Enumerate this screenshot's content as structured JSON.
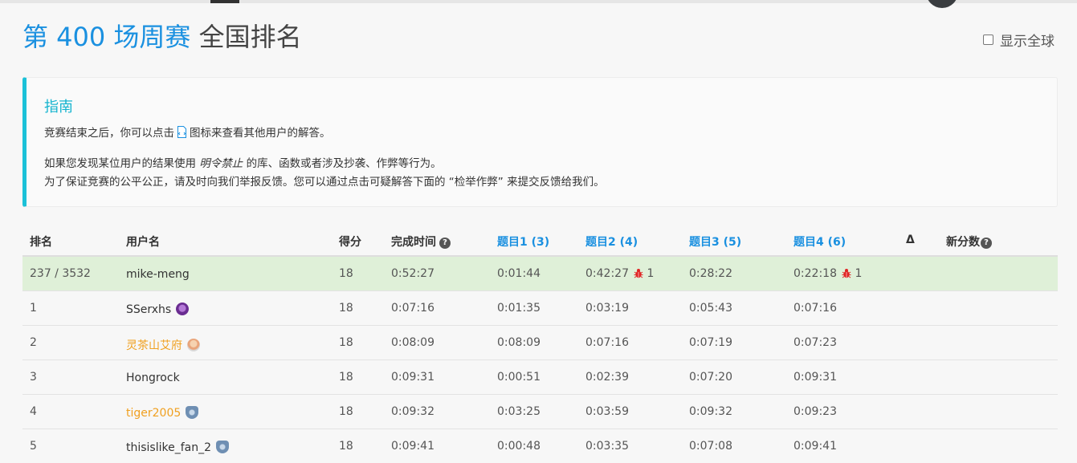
{
  "header": {
    "title_accent": "第 400 场周赛",
    "title_rest": "全国排名",
    "toggle_label": "显示全球"
  },
  "guide": {
    "title": "指南",
    "line1_before": "竞赛结束之后，你可以点击",
    "line1_after": "图标来查看其他用户的解答。",
    "line2_before": "如果您发现某位用户的结果使用",
    "line2_em": "明令禁止",
    "line2_after": "的库、函数或者涉及抄袭、作弊等行为。",
    "line3": "为了保证竞赛的公平公正，请及时向我们举报反馈。您可以通过点击可疑解答下面的 “检举作弊” 来提交反馈给我们。"
  },
  "table": {
    "headers": {
      "rank": "排名",
      "username": "用户名",
      "score": "得分",
      "finish_time": "完成时间",
      "q1": "题目1 (3)",
      "q2": "题目2 (4)",
      "q3": "题目3 (5)",
      "q4": "题目4 (6)",
      "delta": "Δ",
      "new_rating": "新分数"
    },
    "rows": [
      {
        "rank": "237 / 3532",
        "user": "mike-meng",
        "score": "18",
        "time": "0:52:27",
        "q1": "0:01:44",
        "q2": "0:42:27",
        "q2_penalty": "1",
        "q3": "0:28:22",
        "q4": "0:22:18",
        "q4_penalty": "1"
      },
      {
        "rank": "1",
        "user": "SSerxhs",
        "score": "18",
        "time": "0:07:16",
        "q1": "0:01:35",
        "q2": "0:03:19",
        "q3": "0:05:43",
        "q4": "0:07:16"
      },
      {
        "rank": "2",
        "user": "灵茶山艾府",
        "score": "18",
        "time": "0:08:09",
        "q1": "0:08:09",
        "q2": "0:07:16",
        "q3": "0:07:19",
        "q4": "0:07:23"
      },
      {
        "rank": "3",
        "user": "Hongrock",
        "score": "18",
        "time": "0:09:31",
        "q1": "0:00:51",
        "q2": "0:02:39",
        "q3": "0:07:20",
        "q4": "0:09:31"
      },
      {
        "rank": "4",
        "user": "tiger2005",
        "score": "18",
        "time": "0:09:32",
        "q1": "0:03:25",
        "q2": "0:03:59",
        "q3": "0:09:32",
        "q4": "0:09:23"
      },
      {
        "rank": "5",
        "user": "thisislike_fan_2",
        "score": "18",
        "time": "0:09:41",
        "q1": "0:00:48",
        "q2": "0:03:35",
        "q3": "0:07:08",
        "q4": "0:09:41"
      }
    ]
  },
  "icons": {
    "badge_sserxhs": "guardian-badge-icon",
    "badge_lingcha": "user-avatar-icon",
    "badge_tiger": "knight-badge-icon",
    "badge_fan": "knight-badge-icon",
    "penalty": "bug-icon",
    "solution": "solution-file-icon"
  },
  "colors": {
    "accent": "#1a90e0",
    "guide_border": "#1bc1d8",
    "my_row": "#dff0d8",
    "orange_user": "#f0a020",
    "bug": "#e02424"
  }
}
